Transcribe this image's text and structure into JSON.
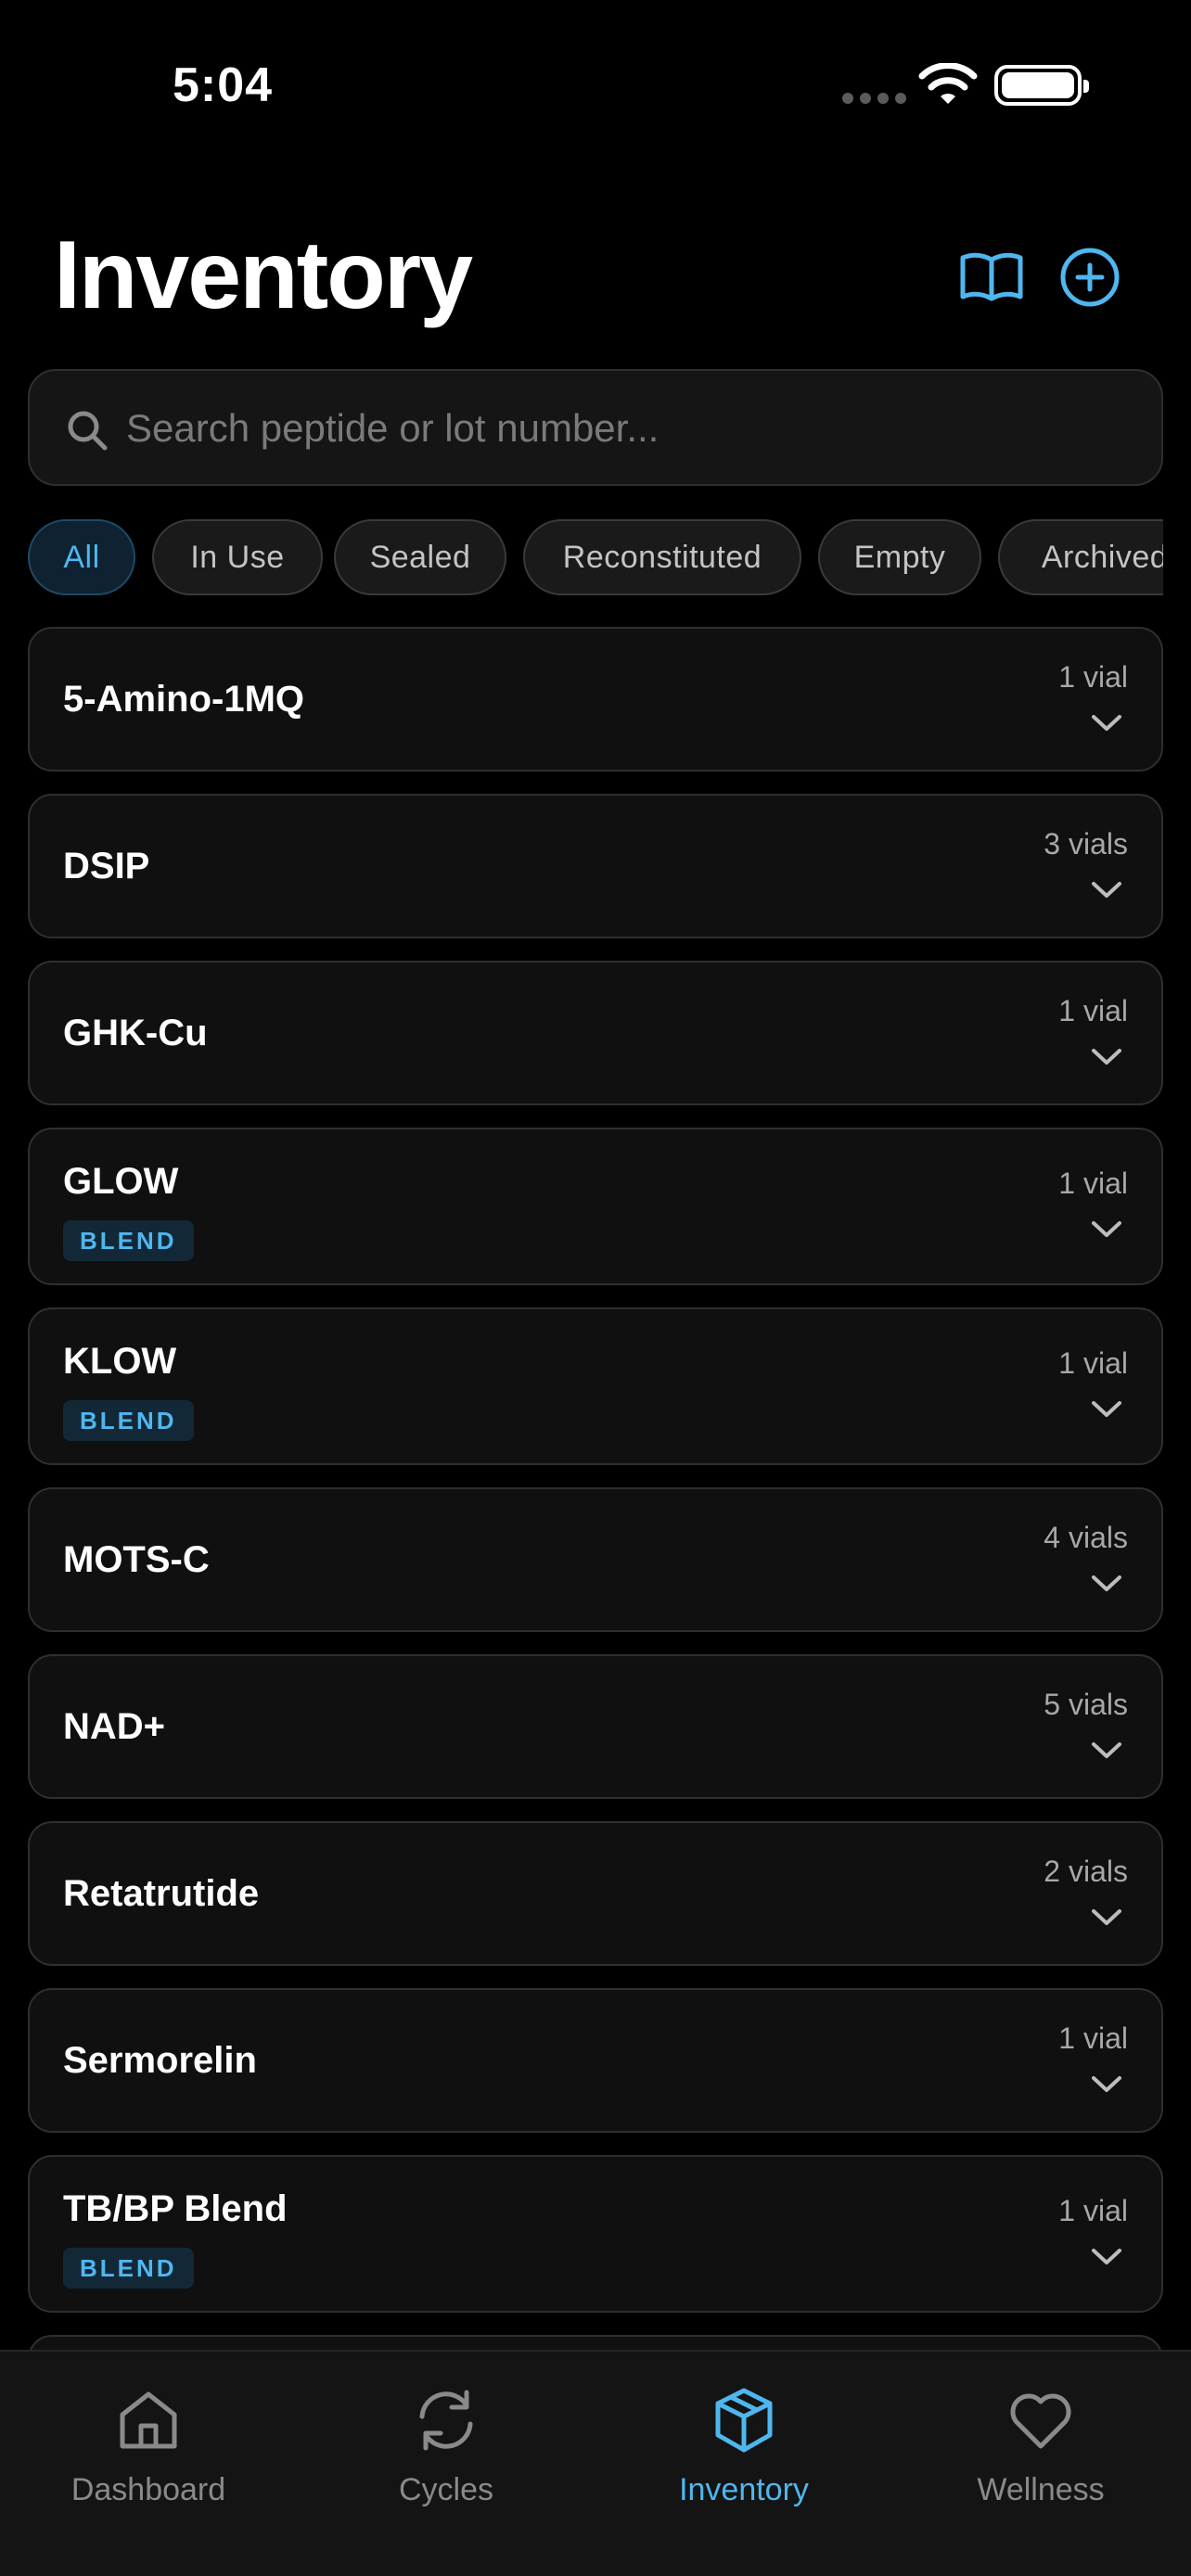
{
  "status_bar": {
    "time": "5:04"
  },
  "header": {
    "title": "Inventory"
  },
  "search": {
    "placeholder": "Search peptide or lot number..."
  },
  "filters": [
    {
      "label": "All",
      "active": true
    },
    {
      "label": "In Use",
      "active": false
    },
    {
      "label": "Sealed",
      "active": false
    },
    {
      "label": "Reconstituted",
      "active": false
    },
    {
      "label": "Empty",
      "active": false
    },
    {
      "label": "Archived",
      "active": false
    }
  ],
  "items": [
    {
      "name": "5-Amino-1MQ",
      "count": "1 vial",
      "badge": ""
    },
    {
      "name": "DSIP",
      "count": "3 vials",
      "badge": ""
    },
    {
      "name": "GHK-Cu",
      "count": "1 vial",
      "badge": ""
    },
    {
      "name": "GLOW",
      "count": "1 vial",
      "badge": "BLEND"
    },
    {
      "name": "KLOW",
      "count": "1 vial",
      "badge": "BLEND"
    },
    {
      "name": "MOTS-C",
      "count": "4 vials",
      "badge": ""
    },
    {
      "name": "NAD+",
      "count": "5 vials",
      "badge": ""
    },
    {
      "name": "Retatrutide",
      "count": "2 vials",
      "badge": ""
    },
    {
      "name": "Sermorelin",
      "count": "1 vial",
      "badge": ""
    },
    {
      "name": "TB/BP Blend",
      "count": "1 vial",
      "badge": "BLEND"
    }
  ],
  "tabbar": [
    {
      "label": "Dashboard",
      "icon": "home-icon",
      "active": false
    },
    {
      "label": "Cycles",
      "icon": "refresh-icon",
      "active": false
    },
    {
      "label": "Inventory",
      "icon": "box-icon",
      "active": true
    },
    {
      "label": "Wellness",
      "icon": "heart-icon",
      "active": false
    }
  ],
  "colors": {
    "accent": "#4fb7ef",
    "background": "#000000",
    "card": "#101010",
    "border": "#2f2f2f",
    "muted_text": "#a8a8a8",
    "badge_bg": "#132836"
  }
}
